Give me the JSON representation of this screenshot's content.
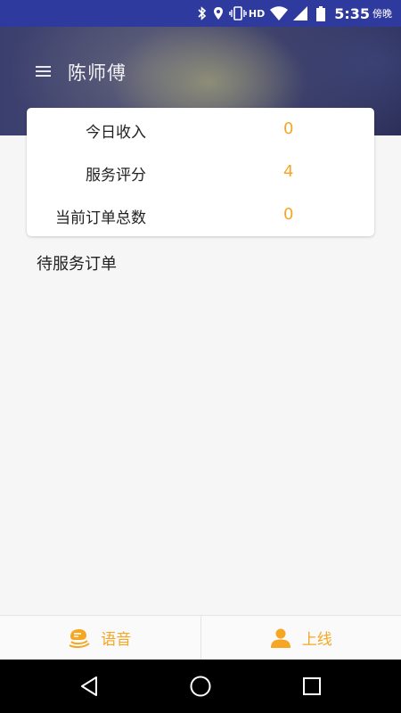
{
  "status_bar": {
    "hd": "HD",
    "time": "5:35",
    "ampm": "傍晚"
  },
  "header": {
    "title": "陈师傅"
  },
  "stats": [
    {
      "label": "今日收入",
      "value": "0"
    },
    {
      "label": "服务评分",
      "value": "4"
    },
    {
      "label": "当前订单总数",
      "value": "0"
    }
  ],
  "section": {
    "title": "待服务订单"
  },
  "bottom_bar": {
    "voice_label": "语音",
    "online_label": "上线"
  },
  "colors": {
    "status_bar": "#2f3a9e",
    "accent": "#f5a623"
  },
  "icons": {
    "status": [
      "bluetooth-icon",
      "location-icon",
      "vibrate-icon",
      "wifi-icon",
      "signal-icon",
      "battery-icon"
    ],
    "menu": "menu-icon",
    "voice": "voice-icon",
    "online": "person-icon",
    "nav": [
      "back-icon",
      "home-icon",
      "recents-icon"
    ]
  }
}
